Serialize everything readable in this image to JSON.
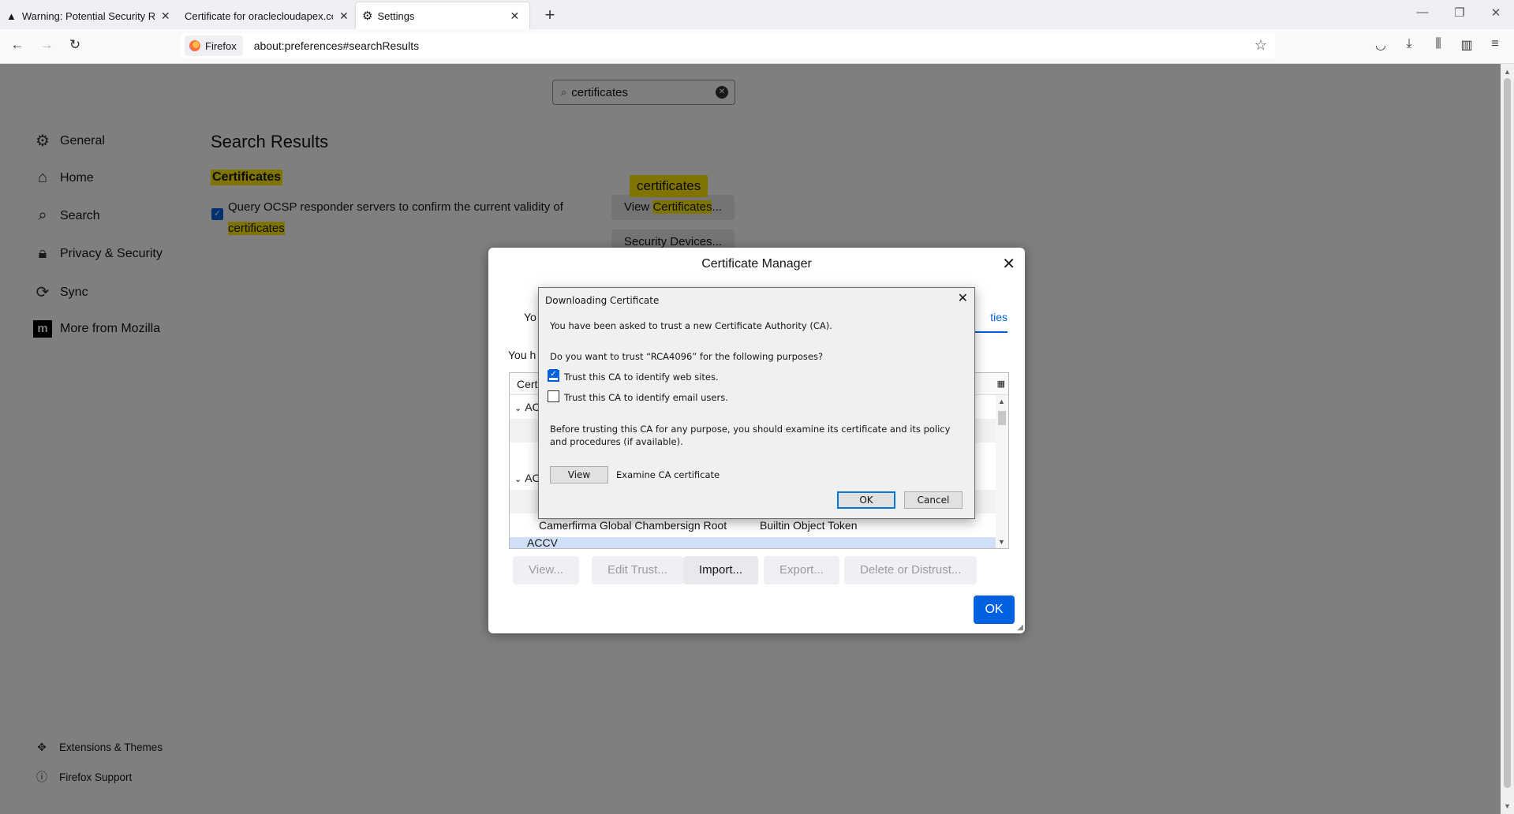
{
  "browser": {
    "tabs": [
      {
        "title": "Warning: Potential Security Risk",
        "icon": "warning-icon"
      },
      {
        "title": "Certificate for oraclecloudapex.com"
      },
      {
        "title": "Settings",
        "icon": "gear-icon"
      }
    ],
    "identity_label": "Firefox",
    "url": "about:preferences#searchResults"
  },
  "settings": {
    "search_value": "certificates",
    "categories": [
      {
        "label": "General",
        "icon": "gear-icon"
      },
      {
        "label": "Home",
        "icon": "home-icon"
      },
      {
        "label": "Search",
        "icon": "search-icon"
      },
      {
        "label": "Privacy & Security",
        "icon": "lock-icon"
      },
      {
        "label": "Sync",
        "icon": "sync-icon"
      },
      {
        "label": "More from Mozilla",
        "icon": "mozilla-icon"
      }
    ],
    "footer_links": [
      {
        "label": "Extensions & Themes",
        "icon": "puzzle-icon"
      },
      {
        "label": "Firefox Support",
        "icon": "help-icon"
      }
    ],
    "results_heading": "Search Results",
    "section_heading": "Certificates",
    "ocsp_label_prefix": "Query OCSP responder servers to confirm the current validity of",
    "ocsp_label_highlight": "certificates",
    "ocsp_checked": true,
    "bubble_text": "certificates",
    "view_certs_prefix": "View ",
    "view_certs_highlight": "Certificates",
    "view_certs_suffix": "...",
    "security_devices": "Security Devices..."
  },
  "cert_manager": {
    "title": "Certificate Manager",
    "tab_partial_left": "Yo",
    "tab_partial_right": "ties",
    "desc_partial": "You h",
    "tree_header_partial": "Cert",
    "rows": [
      {
        "text": "AC",
        "kind": "group"
      },
      {
        "text": "",
        "kind": "blank"
      },
      {
        "text": "",
        "kind": "blank"
      },
      {
        "text": "AC",
        "kind": "group"
      },
      {
        "text": "",
        "kind": "blank"
      },
      {
        "name": "Camerfirma Global Chambersign Root",
        "token": "Builtin Object Token",
        "kind": "cert"
      },
      {
        "text": "ACCV",
        "kind": "group"
      }
    ],
    "buttons": {
      "view": "View...",
      "edit_trust": "Edit Trust...",
      "import": "Import...",
      "export": "Export...",
      "delete": "Delete or Distrust..."
    },
    "ok": "OK"
  },
  "download_dialog": {
    "title": "Downloading Certificate",
    "line1": "You have been asked to trust a new Certificate Authority (CA).",
    "line2": "Do you want to trust “RCA4096” for the following purposes?",
    "opt_web": "Trust this CA to identify web sites.",
    "opt_web_checked": true,
    "opt_email": "Trust this CA to identify email users.",
    "opt_email_checked": false,
    "note": "Before trusting this CA for any purpose, you should examine its certificate and its policy and procedures (if available).",
    "view_button": "View",
    "view_label": "Examine CA certificate",
    "ok": "OK",
    "cancel": "Cancel"
  }
}
